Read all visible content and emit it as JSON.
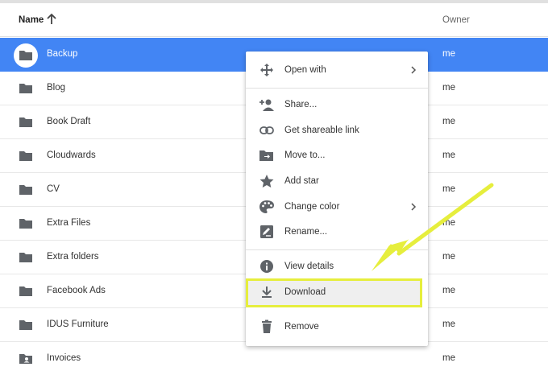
{
  "header": {
    "name_label": "Name",
    "owner_label": "Owner",
    "sort_icon": "arrow-up-icon"
  },
  "files": [
    {
      "name": "Backup",
      "owner": "me",
      "selected": true
    },
    {
      "name": "Blog",
      "owner": "me"
    },
    {
      "name": "Book Draft",
      "owner": "me"
    },
    {
      "name": "Cloudwards",
      "owner": "me"
    },
    {
      "name": "CV",
      "owner": "me"
    },
    {
      "name": "Extra Files",
      "owner": "me"
    },
    {
      "name": "Extra folders",
      "owner": "me"
    },
    {
      "name": "Facebook Ads",
      "owner": "me"
    },
    {
      "name": "IDUS Furniture",
      "owner": "me"
    },
    {
      "name": "Invoices",
      "owner": "me",
      "icon": "shared-folder-icon"
    }
  ],
  "context_menu": {
    "open_with": "Open with",
    "share": "Share...",
    "get_link": "Get shareable link",
    "move_to": "Move to...",
    "add_star": "Add star",
    "change_color": "Change color",
    "rename": "Rename...",
    "view_details": "View details",
    "download": "Download",
    "remove": "Remove"
  },
  "colors": {
    "selection": "#4285f4",
    "highlight_border": "#e6ee3d",
    "arrow": "#e6ee3d"
  }
}
